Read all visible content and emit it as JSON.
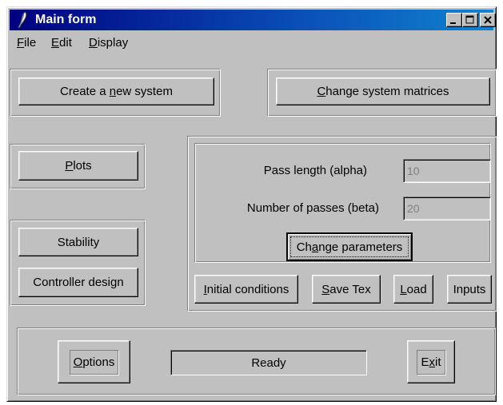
{
  "window": {
    "title": "Main form",
    "icon": "feather-icon",
    "controls": [
      "minimize-icon",
      "maximize-icon",
      "close-icon"
    ]
  },
  "menu": {
    "items": [
      {
        "label": "File",
        "mnemonic": "F",
        "rest": "ile"
      },
      {
        "label": "Edit",
        "mnemonic": "E",
        "rest": "dit"
      },
      {
        "label": "Display",
        "mnemonic": "D",
        "rest": "isplay"
      }
    ]
  },
  "buttons": {
    "create_system": {
      "pre": "Create a ",
      "mn": "n",
      "post": "ew system"
    },
    "change_matrices": {
      "pre": "",
      "mn": "C",
      "post": "hange system matrices"
    },
    "plots": {
      "pre": "",
      "mn": "P",
      "post": "lots"
    },
    "stability": {
      "pre": "Stability",
      "mn": "",
      "post": ""
    },
    "controller_design": {
      "pre": "Controller design",
      "mn": "",
      "post": ""
    },
    "change_parameters": {
      "pre": "Ch",
      "mn": "a",
      "post": "nge parameters"
    },
    "initial_conditions": {
      "pre": "",
      "mn": "I",
      "post": "nitial conditions"
    },
    "save_tex": {
      "pre": "",
      "mn": "S",
      "post": "ave Tex"
    },
    "load": {
      "pre": "",
      "mn": "L",
      "post": "oad"
    },
    "inputs": {
      "pre": "Inputs",
      "mn": "",
      "post": ""
    },
    "options": {
      "pre": "",
      "mn": "O",
      "post": "ptions"
    },
    "exit": {
      "pre": "E",
      "mn": "x",
      "post": "it"
    }
  },
  "parameters": {
    "pass_length": {
      "label": "Pass length (alpha)",
      "value": "10"
    },
    "num_passes": {
      "label": "Number of passes (beta)",
      "value": "20"
    }
  },
  "status": {
    "text": "Ready"
  },
  "colors": {
    "face": "#c0c0c0",
    "title_start": "#000080",
    "title_end": "#1084d0",
    "disabled_text": "#808080"
  }
}
